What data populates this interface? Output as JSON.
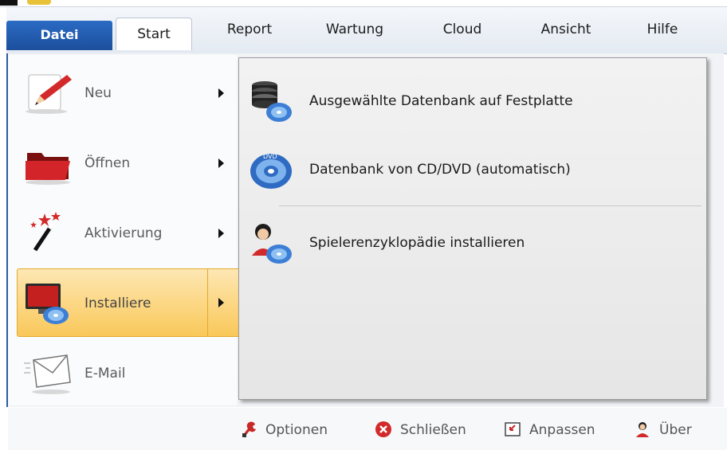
{
  "ribbon": {
    "tabs": [
      {
        "label": "Datei"
      },
      {
        "label": "Start"
      },
      {
        "label": "Report"
      },
      {
        "label": "Wartung"
      },
      {
        "label": "Cloud"
      },
      {
        "label": "Ansicht"
      },
      {
        "label": "Hilfe"
      }
    ]
  },
  "left_menu": {
    "items": [
      {
        "label": "Neu",
        "icon": "pencil-icon",
        "has_submenu": true
      },
      {
        "label": "Öffnen",
        "icon": "folder-icon",
        "has_submenu": true
      },
      {
        "label": "Aktivierung",
        "icon": "magic-wand-icon",
        "has_submenu": true
      },
      {
        "label": "Installiere",
        "icon": "monitor-disc-icon",
        "has_submenu": true,
        "active": true
      },
      {
        "label": "E-Mail",
        "icon": "envelope-icon",
        "has_submenu": false
      }
    ]
  },
  "submenu": {
    "items": [
      {
        "label": "Ausgewählte Datenbank auf Festplatte",
        "icon": "database-disc-icon"
      },
      {
        "label": "Datenbank von CD/DVD (automatisch)",
        "icon": "dvd-icon"
      },
      {
        "label": "Spielerenzyklopädie installieren",
        "icon": "player-disc-icon"
      }
    ]
  },
  "footer": {
    "buttons": [
      {
        "label": "Optionen",
        "icon": "wrench-icon"
      },
      {
        "label": "Schließen",
        "icon": "close-circle-icon"
      },
      {
        "label": "Anpassen",
        "icon": "window-arrow-icon"
      },
      {
        "label": "Über",
        "icon": "user-icon"
      }
    ]
  },
  "colors": {
    "datei_tab": "#1c4f9c",
    "active_item": "#f9c85a",
    "active_border": "#e3a92c"
  }
}
